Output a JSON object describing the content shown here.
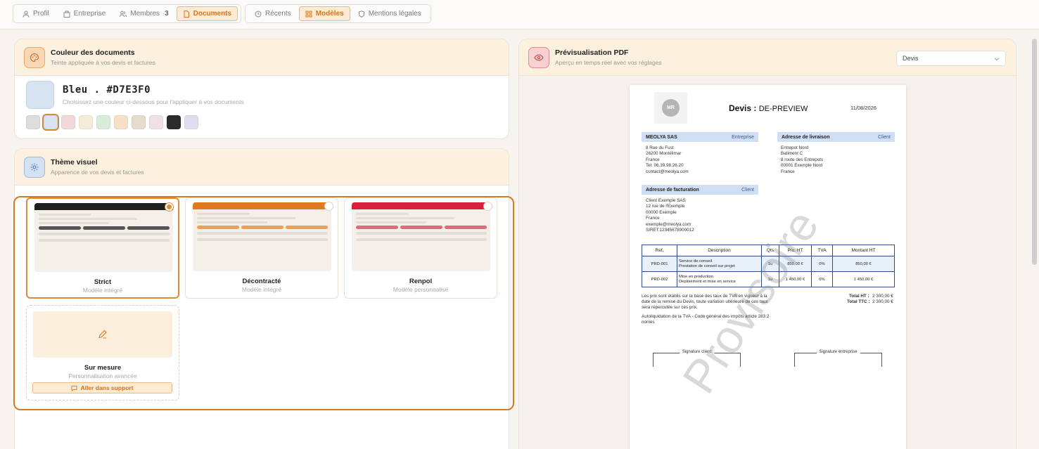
{
  "nav": {
    "group1": [
      {
        "label": "Profil",
        "icon": "user-icon"
      },
      {
        "label": "Entreprise",
        "icon": "building-icon"
      },
      {
        "label": "Membres",
        "icon": "users-icon",
        "count": "3"
      },
      {
        "label": "Documents",
        "icon": "document-icon",
        "active": true
      }
    ],
    "group2": [
      {
        "label": "Récents",
        "icon": "clock-icon"
      },
      {
        "label": "Modèles",
        "icon": "grid-icon",
        "active": true
      },
      {
        "label": "Mentions légales",
        "icon": "shield-icon"
      }
    ]
  },
  "color_panel": {
    "title": "Couleur des documents",
    "subtitle": "Teinte appliquée à vos devis et factures",
    "selected_name": "Bleu . #D7E3F0",
    "hint": "Choisissez une couleur ci-dessous pour l'appliquer à vos documents",
    "swatches": [
      "#dcdcdc",
      "#D7E3F0",
      "#f2d9d9",
      "#f3ecd6",
      "#d9ebd9",
      "#f6e0c7",
      "#e6dccd",
      "#f1e0ea",
      "#2b2b2b",
      "#e3dcf1"
    ],
    "selected_index": 1
  },
  "theme_panel": {
    "title": "Thème visuel",
    "subtitle": "Apparence de vos devis et factures",
    "cards": [
      {
        "name": "Strict",
        "sub": "Modèle intégré",
        "accent": "#1f1f1f",
        "pill": "#555555",
        "selected": true
      },
      {
        "name": "Décontracté",
        "sub": "Modèle intégré",
        "accent": "#e07a1f",
        "pill": "#ef9f55",
        "selected": false
      },
      {
        "name": "Renpol",
        "sub": "Modèle personnalisé",
        "accent": "#d6203c",
        "pill": "#e06a7c",
        "selected": false
      }
    ],
    "custom": {
      "name": "Sur mesure",
      "sub": "Personnalisation avancée",
      "button": "Aller dans support"
    }
  },
  "preview_panel": {
    "title": "Prévisualisation PDF",
    "subtitle": "Aperçu en temps réel avec vos réglages",
    "select_value": "Devis"
  },
  "doc": {
    "logo": "MR",
    "title_prefix": "Devis :",
    "title_value": "DE-PREVIEW",
    "date": "11/08/2026",
    "issuer_head": "MEOLYA SAS",
    "issuer_tag": "Entreprise",
    "issuer_lines": [
      "8 Rue du Fust",
      "26200 Montélimar",
      "France",
      "Tel: 06.39.98.26.20",
      "contact@meolya.com"
    ],
    "delivery_head": "Adresse de livraison",
    "delivery_tag": "Client",
    "delivery_lines": [
      "Entrepot Nord",
      "Batiment C",
      "8 route des Entrepots",
      "00001 Exemple Nord",
      "France"
    ],
    "billing_head": "Adresse de facturation",
    "billing_tag": "Client",
    "billing_lines": [
      "Client Exemple SAS",
      "12 rue de l'Exemple",
      "00000 Exemple",
      "France",
      "exemple@meolya.com",
      "SIRET:12345678900012"
    ],
    "table_headers": [
      "Ref.",
      "Description",
      "Qts",
      "P/u. HT",
      "TVA",
      "Montant HT"
    ],
    "rows": [
      {
        "ref": "PRD-001",
        "desc1": "Service de conseil",
        "desc2": "Prestation de conseil sur projet",
        "qty": "1u",
        "pu": "850,00 €",
        "tva": "0%",
        "total": "850,00 €"
      },
      {
        "ref": "PRD-002",
        "desc1": "Mise en production",
        "desc2": "Deploiement et mise en service",
        "qty": "1u",
        "pu": "1 450,00 €",
        "tva": "0%",
        "total": "1 450,00 €"
      }
    ],
    "note1a": "Les prix sont établis sur la base des taux de TVA en vigueur à la",
    "note1b": "date de la remise du Devis, toute variation ultérieure de ces taux",
    "note1c": "sera répercutée sur ces prix.",
    "note2a": "Autoliquidation de la TVA - Code général des impôts article 283.2",
    "note2b": "nonies",
    "total_ht_label": "Total HT :",
    "total_ht": "2 300,00 €",
    "total_ttc_label": "Total TTC :",
    "total_ttc": "2 300,00 €",
    "sig_client": "Signature client",
    "sig_company": "Signature entreprise",
    "watermark": "Provisoire"
  }
}
